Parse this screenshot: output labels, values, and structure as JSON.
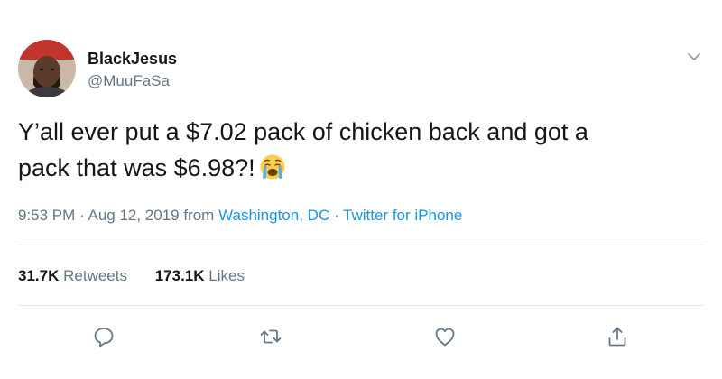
{
  "user": {
    "name": "BlackJesus",
    "handle": "@MuuFaSa"
  },
  "tweet": {
    "line1": "Y’all ever put a $7.02 pack of chicken back and got a",
    "line2": "pack that was $6.98?!",
    "emoji": "crying-face-emoji"
  },
  "meta": {
    "time": "9:53 PM · Aug 12, 2019 from ",
    "location": "Washington, DC",
    "separator": " · ",
    "source": "Twitter for iPhone"
  },
  "stats": {
    "retweets_count": "31.7K",
    "retweets_label": "Retweets",
    "likes_count": "173.1K",
    "likes_label": "Likes"
  },
  "icons": {
    "reply": "reply-icon",
    "retweet": "retweet-icon",
    "like": "like-icon",
    "share": "share-icon",
    "caret": "chevron-down-icon"
  },
  "colors": {
    "link": "#1b95e0",
    "secondary_text": "#657786",
    "primary_text": "#14171a",
    "divider": "#e6ecf0"
  }
}
